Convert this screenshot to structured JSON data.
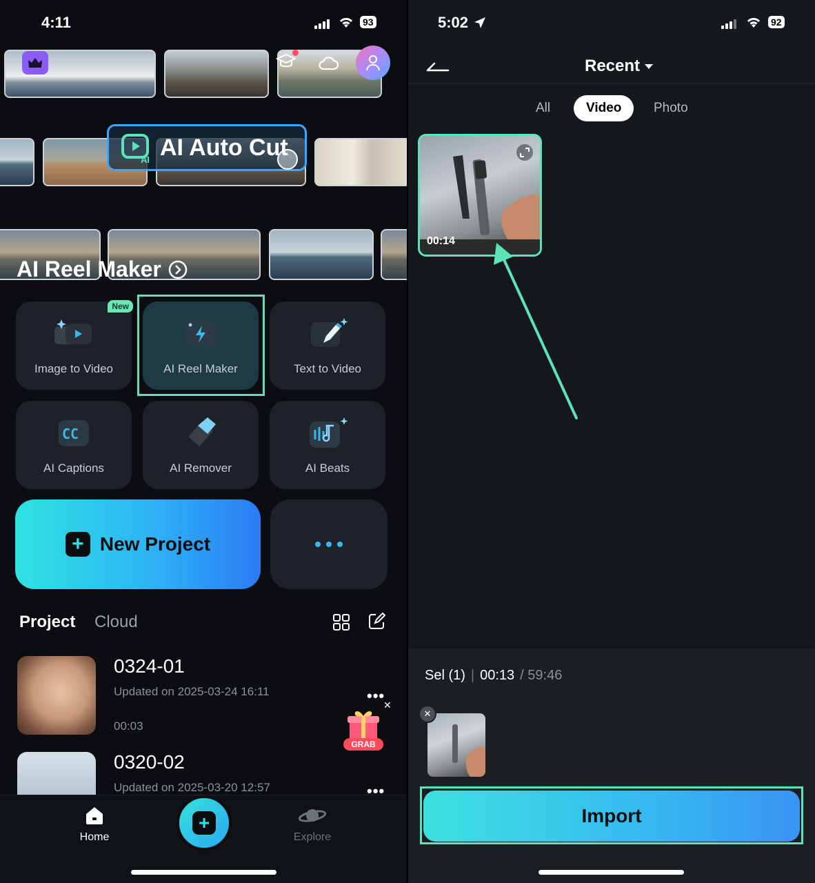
{
  "left": {
    "status": {
      "time": "4:11",
      "battery": "93"
    },
    "banner": {
      "autocut_label": "AI Auto Cut",
      "reel_title": "AI Reel Maker"
    },
    "tools": [
      {
        "label": "Image to Video",
        "badge": "New"
      },
      {
        "label": "AI Reel Maker"
      },
      {
        "label": "Text to Video"
      },
      {
        "label": "AI Captions"
      },
      {
        "label": "AI Remover"
      },
      {
        "label": "AI Beats"
      }
    ],
    "new_project_label": "New Project",
    "tabs": {
      "project": "Project",
      "cloud": "Cloud"
    },
    "projects": [
      {
        "title": "0324-01",
        "updated": "Updated on 2025-03-24 16:11",
        "duration": "00:03"
      },
      {
        "title": "0320-02",
        "updated": "Updated on 2025-03-20 12:57"
      }
    ],
    "promo": {
      "label": "GRAB"
    },
    "nav": {
      "home": "Home",
      "explore": "Explore"
    },
    "colors": {
      "accent": "#5de3b8",
      "button_gradient_start": "#2ee3e0",
      "button_gradient_end": "#2b7cf5"
    }
  },
  "right": {
    "status": {
      "time": "5:02",
      "battery": "92"
    },
    "header": {
      "title": "Recent"
    },
    "filters": [
      "All",
      "Video",
      "Photo"
    ],
    "active_filter": "Video",
    "media": [
      {
        "duration": "00:14"
      }
    ],
    "selection": {
      "label": "Sel (1)",
      "separator": "|",
      "selected_duration": "00:13",
      "total": "/ 59:46"
    },
    "import_label": "Import"
  }
}
